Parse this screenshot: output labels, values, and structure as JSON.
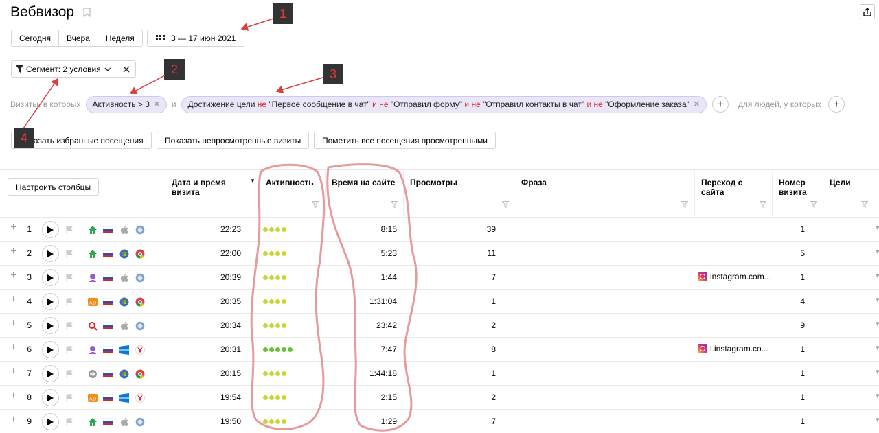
{
  "page": {
    "title": "Вебвизор"
  },
  "period_buttons": [
    "Сегодня",
    "Вчера",
    "Неделя"
  ],
  "date_range": "3 — 17 июн 2021",
  "segment": {
    "label": "Сегмент: 2 условия"
  },
  "filter": {
    "prefix": "Визиты, в которых",
    "chip1": "Активность > 3",
    "and": "и",
    "chip2_parts": [
      "Достижение цели ",
      "не",
      " \"Первое сообщение в чат\" ",
      "и",
      " ",
      "не",
      " \"Отправил форму\" ",
      "и",
      " ",
      "не",
      " \"Отправил контакты в чат\" ",
      "и",
      " ",
      "не",
      " \"Оформление заказа\""
    ],
    "people_text": "для людей, у которых"
  },
  "actions": [
    "Показать избранные посещения",
    "Показать непросмотренные визиты",
    "Пометить все посещения просмотренными"
  ],
  "table": {
    "configure_label": "Настроить столбцы",
    "headers": {
      "datetime": "Дата и время визита",
      "activity": "Активность",
      "time_on_site": "Время на сайте",
      "views": "Просмотры",
      "phrase": "Фраза",
      "referrer": "Переход с сайта",
      "visit_num": "Номер визита",
      "goals": "Цели"
    },
    "rows": [
      {
        "n": "1",
        "time": "22:23",
        "activity": 4,
        "duration": "8:15",
        "views": "39",
        "referrer": "",
        "visit": "1",
        "source": "home",
        "os": "apple",
        "browser": "yandex"
      },
      {
        "n": "2",
        "time": "22:00",
        "activity": 4,
        "duration": "5:23",
        "views": "11",
        "referrer": "",
        "visit": "5",
        "source": "home",
        "os": "windows7",
        "browser": "chrome"
      },
      {
        "n": "3",
        "time": "20:39",
        "activity": 4,
        "duration": "1:44",
        "views": "7",
        "referrer": "instagram.com...",
        "visit": "1",
        "source": "social",
        "os": "apple",
        "browser": "yandex"
      },
      {
        "n": "4",
        "time": "20:35",
        "activity": 4,
        "duration": "1:31:04",
        "views": "1",
        "referrer": "",
        "visit": "4",
        "source": "ad",
        "os": "windows7",
        "browser": "chrome"
      },
      {
        "n": "5",
        "time": "20:34",
        "activity": 4,
        "duration": "23:42",
        "views": "2",
        "referrer": "",
        "visit": "9",
        "source": "search",
        "os": "apple",
        "browser": "yandex"
      },
      {
        "n": "6",
        "time": "20:31",
        "activity": 5,
        "duration": "7:47",
        "views": "8",
        "referrer": "l.instagram.co...",
        "visit": "1",
        "source": "social",
        "os": "windows10",
        "browser": "yandex-y"
      },
      {
        "n": "7",
        "time": "20:15",
        "activity": 4,
        "duration": "1:44:18",
        "views": "1",
        "referrer": "",
        "visit": "1",
        "source": "direct",
        "os": "windows7",
        "browser": "chrome"
      },
      {
        "n": "8",
        "time": "19:54",
        "activity": 4,
        "duration": "2:15",
        "views": "2",
        "referrer": "",
        "visit": "1",
        "source": "ad",
        "os": "windows10",
        "browser": "yandex-y"
      },
      {
        "n": "9",
        "time": "19:50",
        "activity": 4,
        "duration": "1:29",
        "views": "7",
        "referrer": "",
        "visit": "1",
        "source": "home",
        "os": "apple",
        "browser": "yandex"
      }
    ]
  },
  "annotations": [
    "1",
    "2",
    "3",
    "4"
  ],
  "colors": {
    "chip_bg": "#e9e6f7",
    "negation": "#e4232a",
    "dot_active": "#c8d63a",
    "dot_high": "#6bbf32",
    "arrow": "#d94040",
    "highlight": "#e79a9a"
  }
}
